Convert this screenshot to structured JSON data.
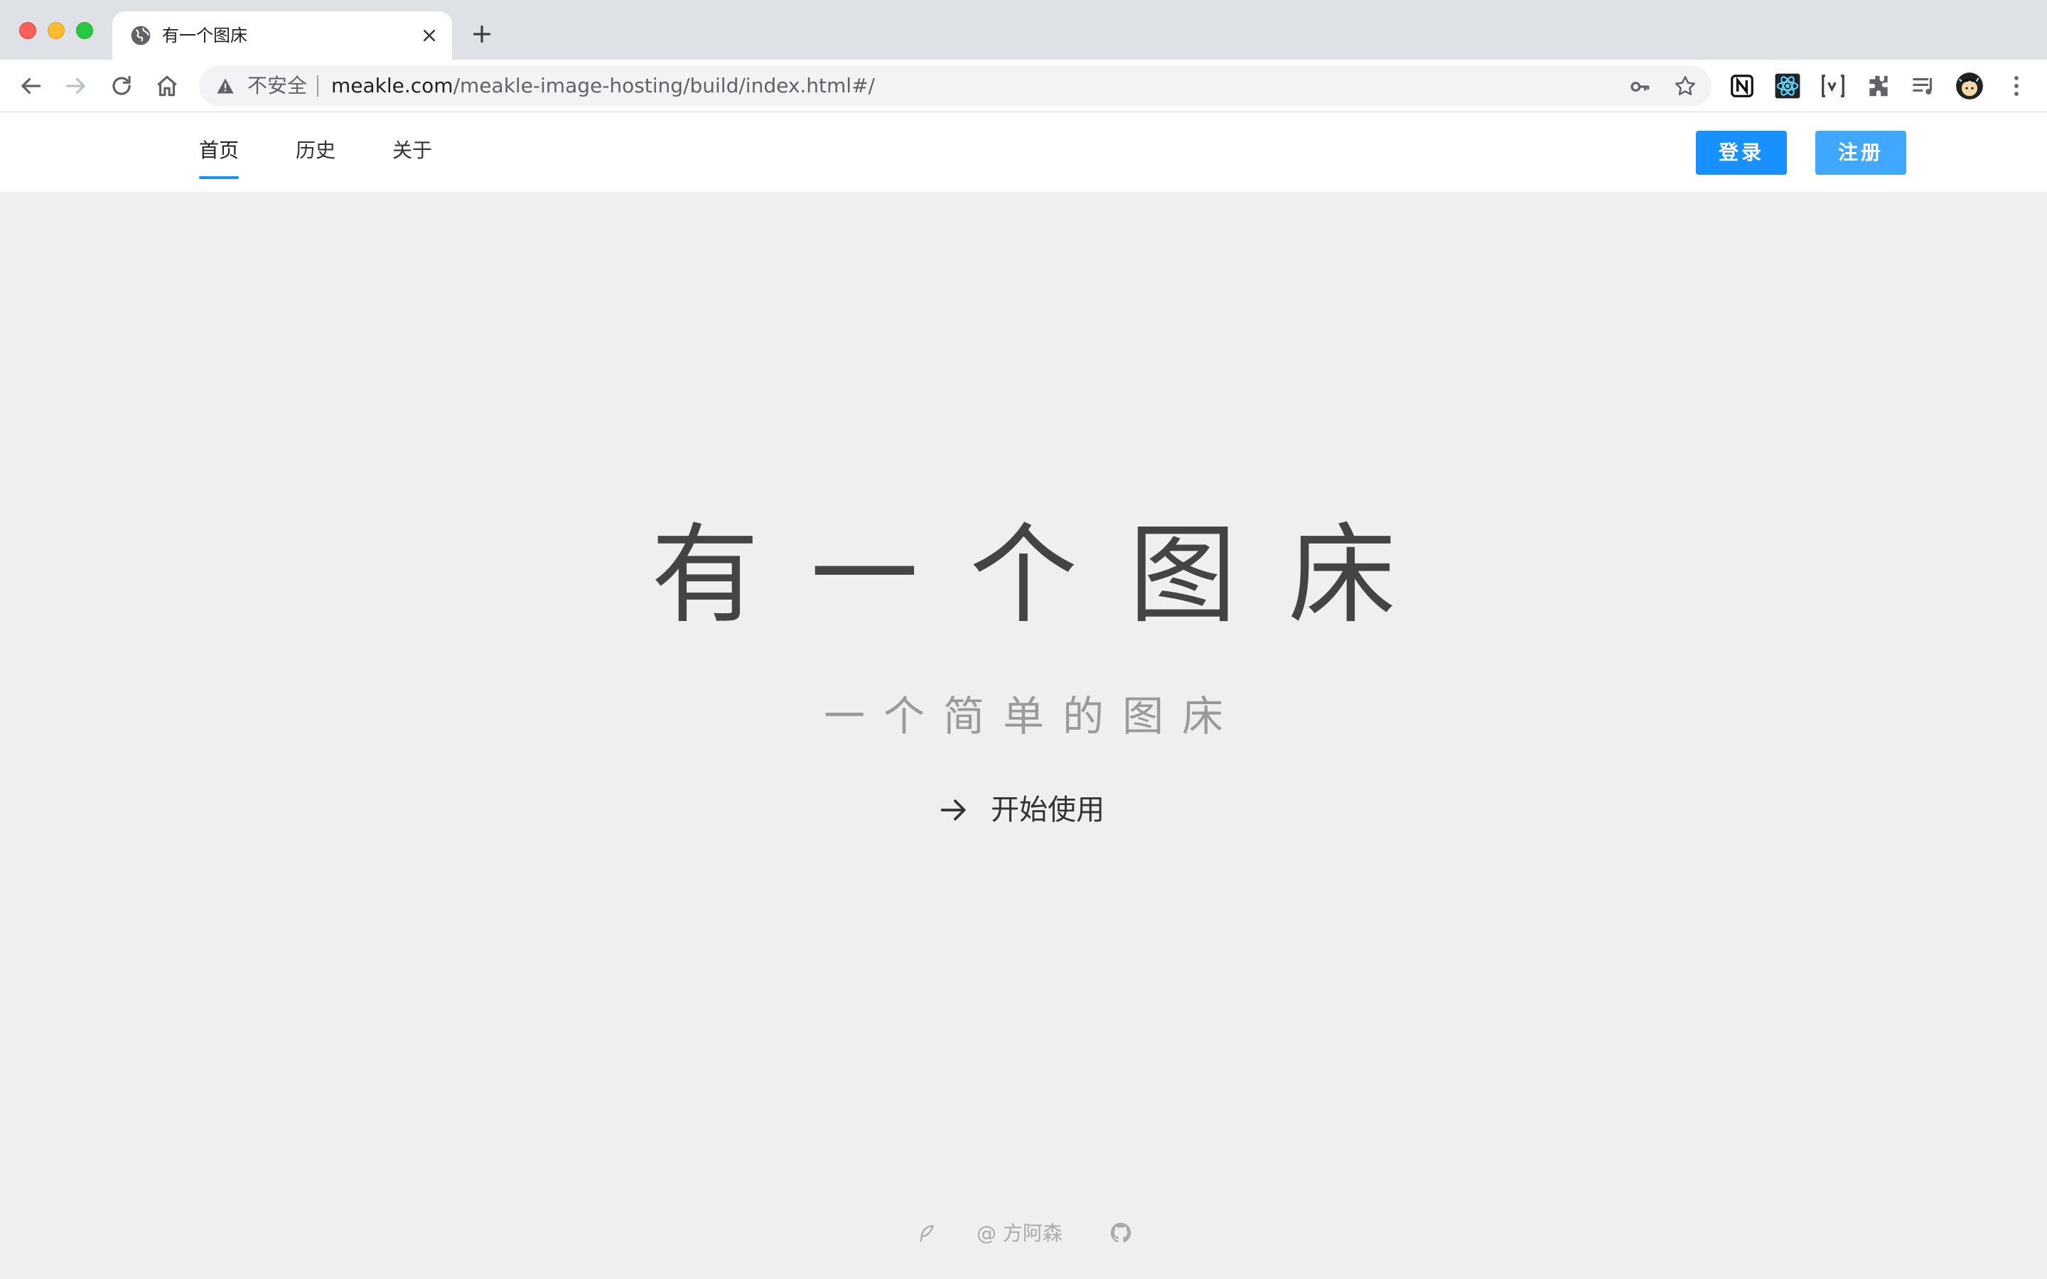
{
  "browser": {
    "tab_title": "有一个图床",
    "security_label": "不安全",
    "url_host": "meakle.com",
    "url_path": "/meakle-image-hosting/build/index.html#/"
  },
  "nav": {
    "items": [
      {
        "label": "首页",
        "active": true
      },
      {
        "label": "历史",
        "active": false
      },
      {
        "label": "关于",
        "active": false
      }
    ],
    "login_label": "登录",
    "register_label": "注册"
  },
  "hero": {
    "title": "有一个图床",
    "subtitle": "一个简单的图床",
    "cta_label": "开始使用"
  },
  "footer": {
    "author": "@ 方阿森"
  },
  "colors": {
    "primary": "#1890ff",
    "primary_light": "#40a9ff",
    "page_bg": "#efefef",
    "title_text": "#444444",
    "subtitle_text": "#9a9a9a"
  }
}
